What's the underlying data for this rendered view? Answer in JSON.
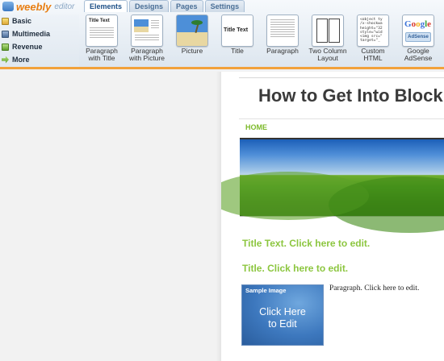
{
  "logo": {
    "word": "weebly",
    "sub": "editor",
    "colors": {
      "word": "#e87e12",
      "accent": "#f2a13a"
    }
  },
  "tabs": [
    {
      "label": "Elements",
      "active": true
    },
    {
      "label": "Designs",
      "active": false
    },
    {
      "label": "Pages",
      "active": false
    },
    {
      "label": "Settings",
      "active": false
    }
  ],
  "categories": [
    {
      "label": "Basic",
      "icon": "page-icon"
    },
    {
      "label": "Multimedia",
      "icon": "film-icon"
    },
    {
      "label": "Revenue",
      "icon": "money-icon"
    },
    {
      "label": "More",
      "icon": "arrow-icon"
    }
  ],
  "elements": [
    {
      "label": "Paragraph\nwith Title",
      "icon": "paragraph-with-title-icon",
      "thumb_title": "Title Text"
    },
    {
      "label": "Paragraph\nwith Picture",
      "icon": "paragraph-with-picture-icon"
    },
    {
      "label": "Picture",
      "icon": "picture-icon"
    },
    {
      "label": "Title",
      "icon": "title-icon",
      "thumb_title": "Title Text"
    },
    {
      "label": "Paragraph",
      "icon": "paragraph-icon"
    },
    {
      "label": "Two Column\nLayout",
      "icon": "two-column-icon"
    },
    {
      "label": "Custom\nHTML",
      "icon": "code-icon",
      "code": "<object ty\n/x-shockwa\nheight=\"32\nstyle=\"wid\n<img src=\"\ntarget=\"_"
    },
    {
      "label": "Google\nAdSense",
      "icon": "google-adsense-icon",
      "logo": "Google",
      "button": "AdSense"
    }
  ],
  "site": {
    "title": "How to Get Into Block",
    "nav": [
      "HOME"
    ],
    "title_text_1": "Title Text. Click here to edit.",
    "title_text_2": "Title. Click here to edit.",
    "sample_label": "Sample Image",
    "click_to_edit": "Click Here\nto Edit",
    "paragraph": "Paragraph. Click here to edit.",
    "colors": {
      "accent_green": "#8cc63f",
      "nav_green": "#7cba2a"
    }
  }
}
